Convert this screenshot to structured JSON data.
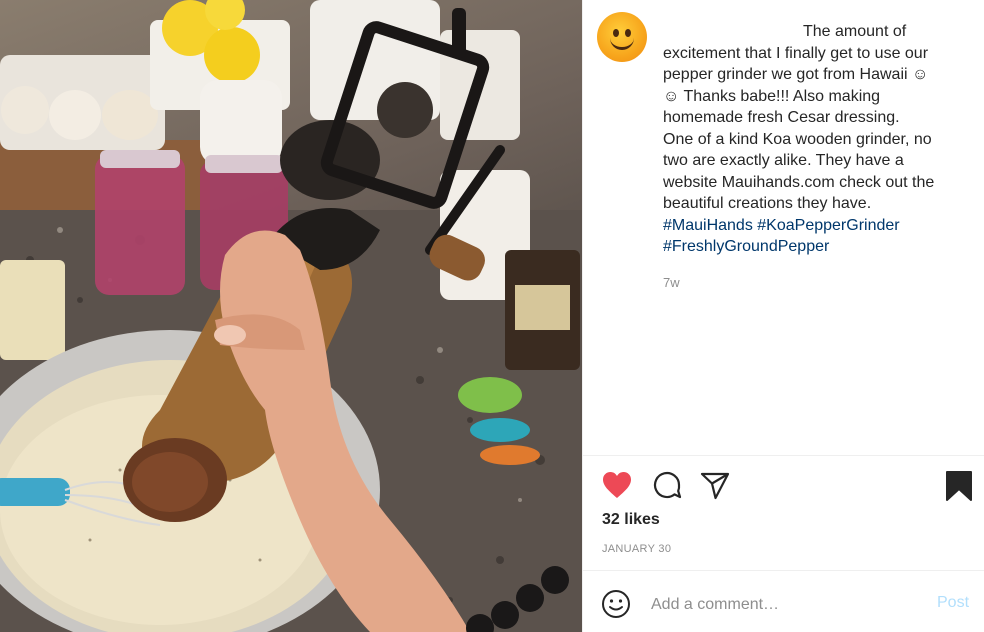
{
  "post": {
    "caption_lines": [
      "The amount of",
      "excitement that I finally get to use our",
      "pepper grinder we got from Hawaii ☺︎",
      "☺︎ Thanks babe!!! Also making",
      "homemade fresh Cesar dressing.",
      "One of a kind Koa wooden grinder, no",
      "two are exactly alike. They have a",
      "website Mauihands.com check out the",
      "beautiful creations they have."
    ],
    "hashtags": [
      "#MauiHands",
      "#KoaPepperGrinder",
      "#FreshlyGroundPepper"
    ],
    "age": "7w",
    "likes": "32 likes",
    "date": "JANUARY 30"
  },
  "comment": {
    "placeholder": "Add a comment…",
    "post_label": "Post"
  },
  "icons": {
    "like": "heart-icon",
    "comment": "comment-bubble-icon",
    "share": "paper-plane-icon",
    "save": "bookmark-icon",
    "emoji": "emoji-smiley-icon"
  },
  "colors": {
    "like_active": "#ed4956",
    "hashtag": "#00376b",
    "meta_gray": "#8e8e8e",
    "post_disabled": "#b2dffc"
  }
}
